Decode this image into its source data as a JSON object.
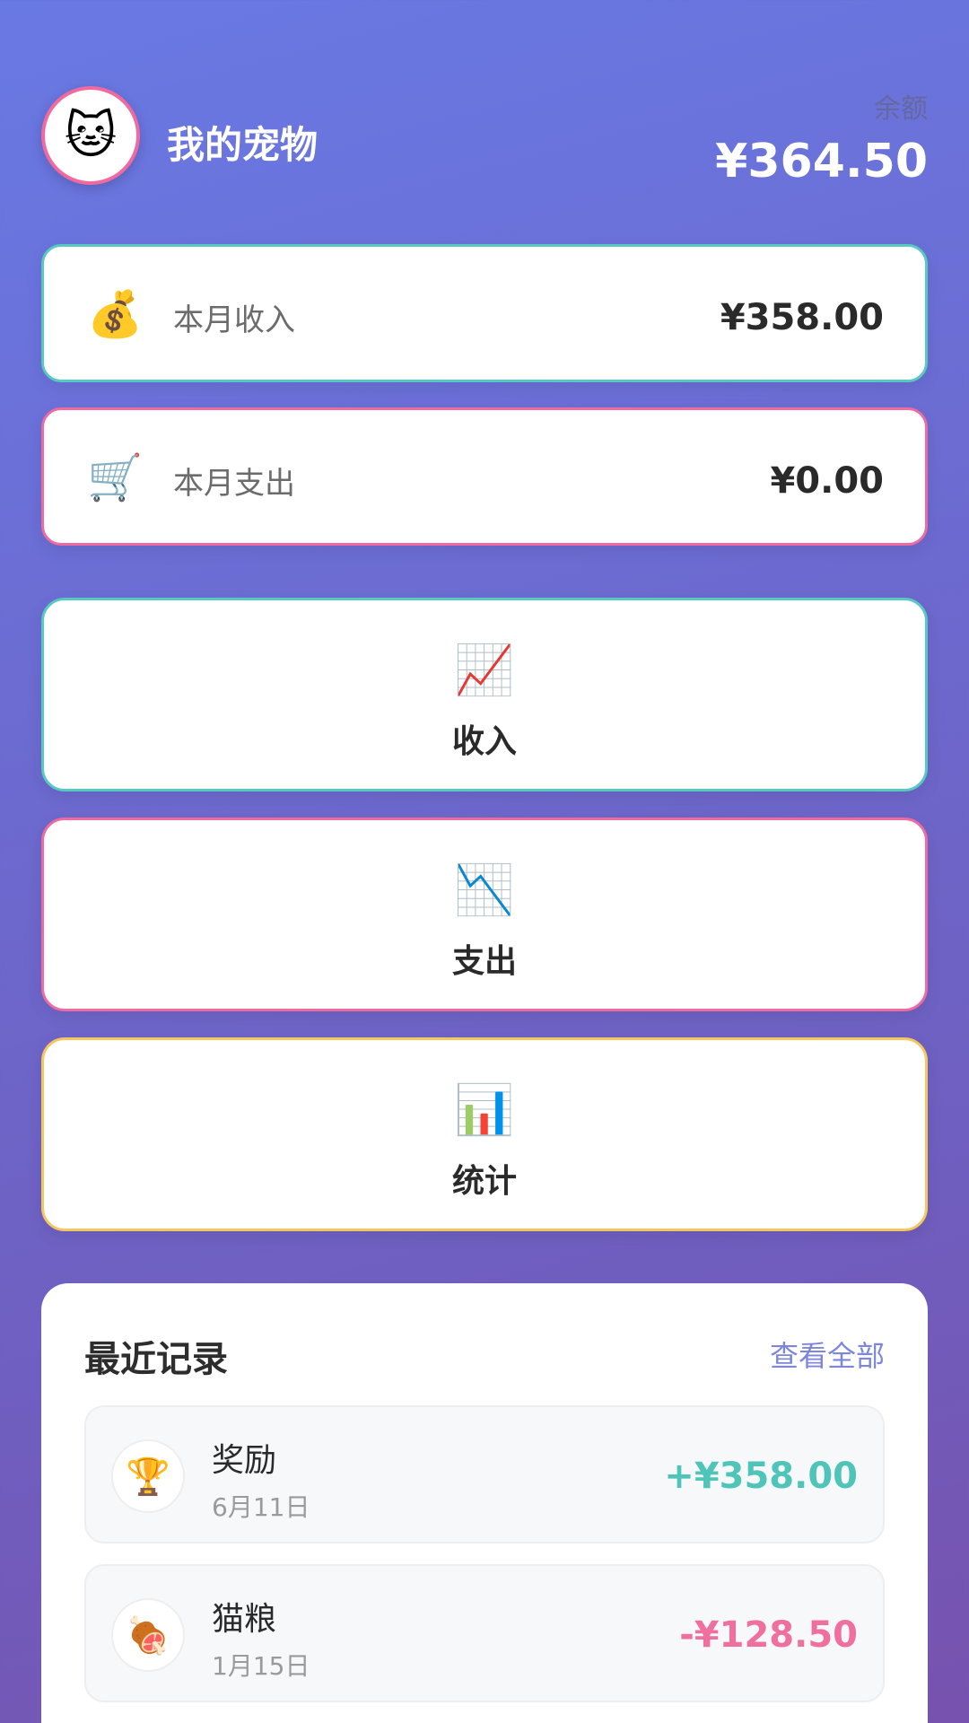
{
  "app": {
    "title_partial": "",
    "pet_name": "我的宠物",
    "pet_avatar_emoji": "🐱",
    "balance_label": "余额",
    "balance_value": "¥364.50"
  },
  "summary": {
    "income": {
      "icon": "💰",
      "label": "本月收入",
      "value": "¥358.00",
      "border_color": "#56c9c3"
    },
    "expense": {
      "icon": "🛒",
      "label": "本月支出",
      "value": "¥0.00",
      "border_color": "#ee6aa0"
    }
  },
  "actions": [
    {
      "icon": "📈",
      "label": "收入",
      "border_color": "#56c9c3"
    },
    {
      "icon": "📉",
      "label": "支出",
      "border_color": "#ee6aa0"
    },
    {
      "icon": "📊",
      "label": "统计",
      "border_color": "#f5c560"
    }
  ],
  "recent": {
    "title": "最近记录",
    "view_all": "查看全部",
    "records": [
      {
        "icon": "🏆",
        "name": "奖励",
        "date": "6月11日",
        "amount": "+¥358.00",
        "color": "#4fc4b8"
      },
      {
        "icon": "🍖",
        "name": "猫粮",
        "date": "1月15日",
        "amount": "-¥128.50",
        "color": "#ef6f9e"
      }
    ]
  }
}
